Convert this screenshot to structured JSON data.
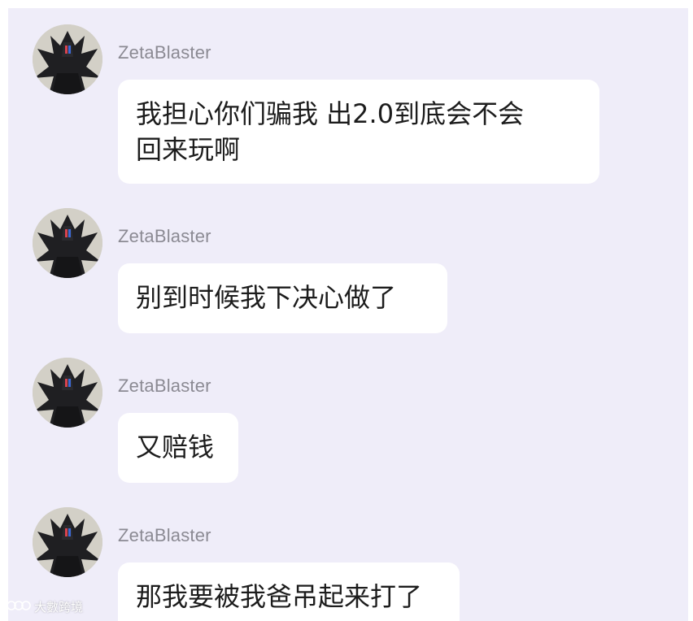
{
  "chat": {
    "background": "#efedf9",
    "messages": [
      {
        "username": "ZetaBlaster",
        "text": "我担心你们骗我 出2.0到底会不会\n回来玩啊"
      },
      {
        "username": "ZetaBlaster",
        "text": "别到时候我下决心做了"
      },
      {
        "username": "ZetaBlaster",
        "text": "又赔钱"
      },
      {
        "username": "ZetaBlaster",
        "text": "那我要被我爸吊起来打了"
      }
    ]
  },
  "avatar": {
    "icon": "dark-armored-character-avatar"
  },
  "watermark": {
    "text": "大數跨境",
    "icon": "logo-icon"
  }
}
